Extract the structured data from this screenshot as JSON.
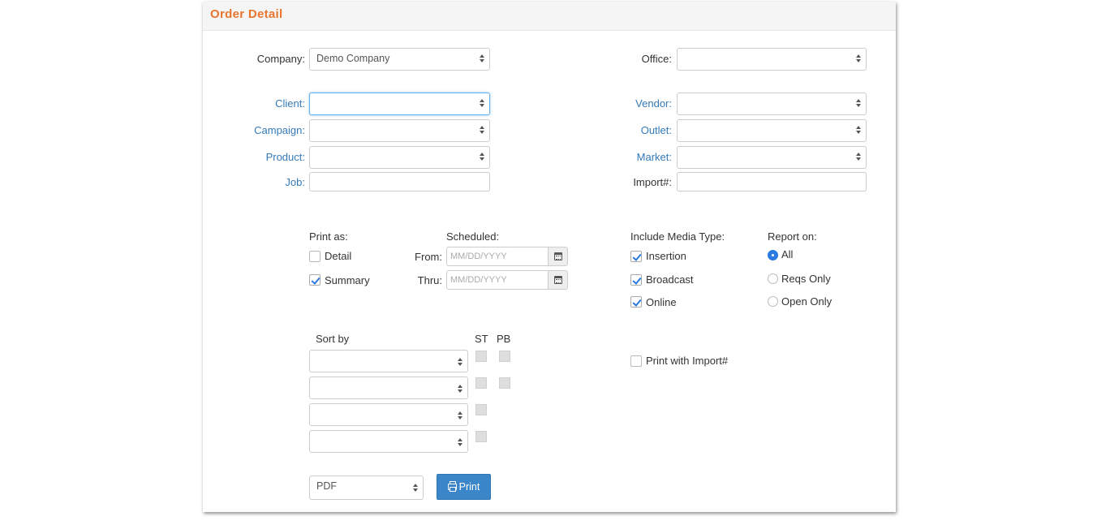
{
  "title": "Order Detail",
  "fields": {
    "company": {
      "label": "Company:",
      "value": "Demo Company"
    },
    "office": {
      "label": "Office:",
      "value": ""
    },
    "client": {
      "label": "Client:",
      "value": ""
    },
    "vendor": {
      "label": "Vendor:",
      "value": ""
    },
    "campaign": {
      "label": "Campaign:",
      "value": ""
    },
    "outlet": {
      "label": "Outlet:",
      "value": ""
    },
    "product": {
      "label": "Product:",
      "value": ""
    },
    "market": {
      "label": "Market:",
      "value": ""
    },
    "job": {
      "label": "Job:",
      "value": ""
    },
    "import": {
      "label": "Import#:",
      "value": ""
    }
  },
  "print_as": {
    "label": "Print as:",
    "detail": {
      "label": "Detail",
      "checked": false
    },
    "summary": {
      "label": "Summary",
      "checked": true
    }
  },
  "scheduled": {
    "label": "Scheduled:",
    "from_label": "From:",
    "thru_label": "Thru:",
    "from_placeholder": "MM/DD/YYYY",
    "thru_placeholder": "MM/DD/YYYY"
  },
  "media_type": {
    "label": "Include Media Type:",
    "insertion": {
      "label": "Insertion",
      "checked": true
    },
    "broadcast": {
      "label": "Broadcast",
      "checked": true
    },
    "online": {
      "label": "Online",
      "checked": true
    }
  },
  "report_on": {
    "label": "Report on:",
    "options": [
      "All",
      "Reqs Only",
      "Open Only"
    ],
    "selected": "All"
  },
  "sort": {
    "label": "Sort by",
    "st_label": "ST",
    "pb_label": "PB",
    "rows": [
      "",
      "",
      "",
      ""
    ]
  },
  "print_with_import": {
    "label": "Print with Import#",
    "checked": false
  },
  "output": {
    "format": "PDF",
    "print_label": "Print"
  },
  "colors": {
    "accent": "#e8752e",
    "link": "#337ab7",
    "button": "#3a86c8",
    "check": "#2a7ae2"
  }
}
